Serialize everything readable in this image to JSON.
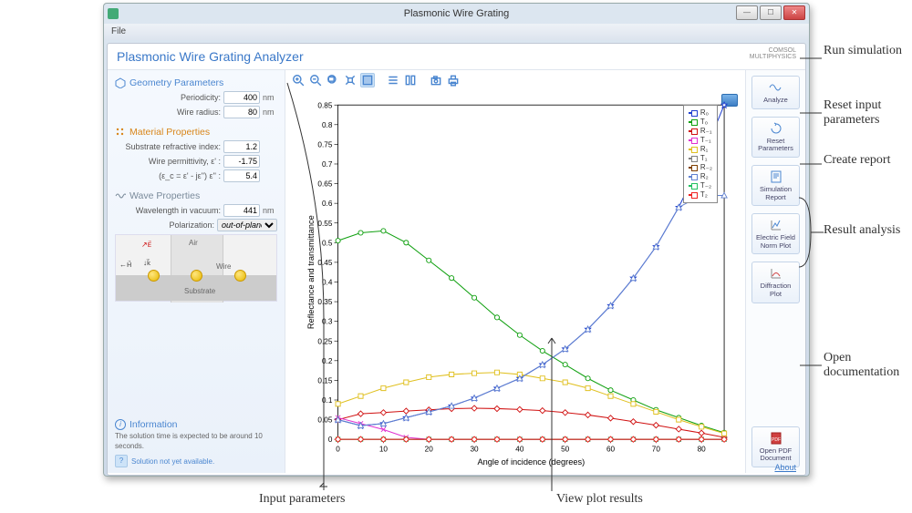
{
  "window": {
    "title": "Plasmonic Wire Grating",
    "menu_file": "File"
  },
  "header": {
    "title": "Plasmonic Wire Grating Analyzer",
    "brand1": "COMSOL",
    "brand2": "MULTIPHYSICS"
  },
  "geom": {
    "title": "Geometry Parameters",
    "periodicity_lbl": "Periodicity:",
    "periodicity_val": "400",
    "periodicity_unit": "nm",
    "radius_lbl": "Wire radius:",
    "radius_val": "80",
    "radius_unit": "nm"
  },
  "mat": {
    "title": "Material Properties",
    "sub_lbl": "Substrate refractive index:",
    "sub_val": "1.2",
    "perm_lbl": "Wire permittivity,    ε' :",
    "perm_val": "-1.75",
    "perm2_lbl": "(ε_c = ε' - jε'')    ε'' :",
    "perm2_val": "5.4"
  },
  "wave": {
    "title": "Wave Properties",
    "wl_lbl": "Wavelength in vacuum:",
    "wl_val": "441",
    "wl_unit": "nm",
    "pol_lbl": "Polarization:",
    "pol_val": "out-of-plane"
  },
  "diagram": {
    "air": "Air",
    "wire": "Wire",
    "substrate": "Substrate",
    "E": "E⃗",
    "H": "H⃗",
    "k": "k⃗"
  },
  "info": {
    "title": "Information",
    "text": "The solution time is expected to be around 10 seconds.",
    "status": "Solution not yet available."
  },
  "buttons": {
    "analyze": "Analyze",
    "reset": "Reset Parameters",
    "report": "Simulation Report",
    "efield": "Electric Field Norm Plot",
    "diff": "Diffraction Plot",
    "pdf": "Open PDF Document"
  },
  "footer": {
    "about": "About"
  },
  "annotations": {
    "run": "Run simulation",
    "reset": "Reset input parameters",
    "report": "Create report",
    "result": "Result analysis",
    "doc": "Open documentation",
    "input": "Input parameters",
    "view": "View plot results"
  },
  "chart_data": {
    "type": "line",
    "xlabel": "Angle of incidence (degrees)",
    "ylabel": "Reflectance and transmittance",
    "xlim": [
      0,
      85
    ],
    "ylim": [
      0,
      0.85
    ],
    "x": [
      0,
      5,
      10,
      15,
      20,
      25,
      30,
      35,
      40,
      45,
      50,
      55,
      60,
      65,
      70,
      75,
      80,
      85
    ],
    "xticks": [
      0,
      10,
      20,
      30,
      40,
      50,
      60,
      70,
      80
    ],
    "yticks": [
      0,
      0.05,
      0.1,
      0.15,
      0.2,
      0.25,
      0.3,
      0.35,
      0.4,
      0.45,
      0.5,
      0.55,
      0.6,
      0.65,
      0.7,
      0.75,
      0.8,
      0.85
    ],
    "series": [
      {
        "name": "R₀",
        "color": "#2040d0",
        "marker": "star",
        "values": [
          0.05,
          0.035,
          0.04,
          0.055,
          0.07,
          0.085,
          0.105,
          0.13,
          0.155,
          0.19,
          0.23,
          0.28,
          0.34,
          0.41,
          0.49,
          0.59,
          0.71,
          0.85
        ]
      },
      {
        "name": "T₀",
        "color": "#10a010",
        "marker": "circle",
        "values": [
          0.505,
          0.525,
          0.53,
          0.5,
          0.455,
          0.41,
          0.36,
          0.31,
          0.265,
          0.225,
          0.19,
          0.155,
          0.125,
          0.1,
          0.075,
          0.055,
          0.035,
          0.017
        ]
      },
      {
        "name": "R₋₁",
        "color": "#d01010",
        "marker": "diamond",
        "values": [
          0.05,
          0.065,
          0.068,
          0.072,
          0.075,
          0.078,
          0.079,
          0.078,
          0.076,
          0.073,
          0.068,
          0.062,
          0.054,
          0.045,
          0.036,
          0.026,
          0.016,
          0.005
        ]
      },
      {
        "name": "T₋₁",
        "color": "#e030d0",
        "marker": "times",
        "values": [
          0.055,
          0.04,
          0.025,
          0.005,
          0,
          0,
          0,
          0,
          0,
          0,
          0,
          0,
          0,
          0,
          0,
          0,
          0,
          0
        ]
      },
      {
        "name": "R₁",
        "color": "#e0c020",
        "marker": "square",
        "values": [
          0.09,
          0.11,
          0.13,
          0.145,
          0.158,
          0.165,
          0.168,
          0.17,
          0.165,
          0.155,
          0.145,
          0.13,
          0.11,
          0.09,
          0.07,
          0.05,
          0.032,
          0.015
        ]
      },
      {
        "name": "T₁",
        "color": "#808080",
        "marker": "plus",
        "values": [
          0,
          0,
          0,
          0,
          0,
          0,
          0,
          0,
          0,
          0,
          0,
          0,
          0,
          0,
          0,
          0,
          0,
          0
        ]
      },
      {
        "name": "R₋₂",
        "color": "#804000",
        "marker": "circle",
        "values": [
          0,
          0,
          0,
          0,
          0,
          0,
          0,
          0,
          0,
          0,
          0,
          0,
          0,
          0,
          0,
          0,
          0,
          0
        ]
      },
      {
        "name": "R₂",
        "color": "#6080d0",
        "marker": "triangle",
        "values": [
          0.05,
          0.035,
          0.04,
          0.055,
          0.07,
          0.085,
          0.105,
          0.13,
          0.155,
          0.19,
          0.23,
          0.28,
          0.34,
          0.41,
          0.49,
          0.59,
          0.62,
          0.62
        ]
      },
      {
        "name": "T₋₂",
        "color": "#20c060",
        "marker": "times",
        "values": [
          0,
          0,
          0,
          0,
          0,
          0,
          0,
          0,
          0,
          0,
          0,
          0,
          0,
          0,
          0,
          0,
          0,
          0
        ]
      },
      {
        "name": "T₂",
        "color": "#f02020",
        "marker": "diamond",
        "values": [
          0,
          0,
          0,
          0,
          0,
          0,
          0,
          0,
          0,
          0,
          0,
          0,
          0,
          0,
          0,
          0,
          0,
          0
        ]
      }
    ]
  }
}
